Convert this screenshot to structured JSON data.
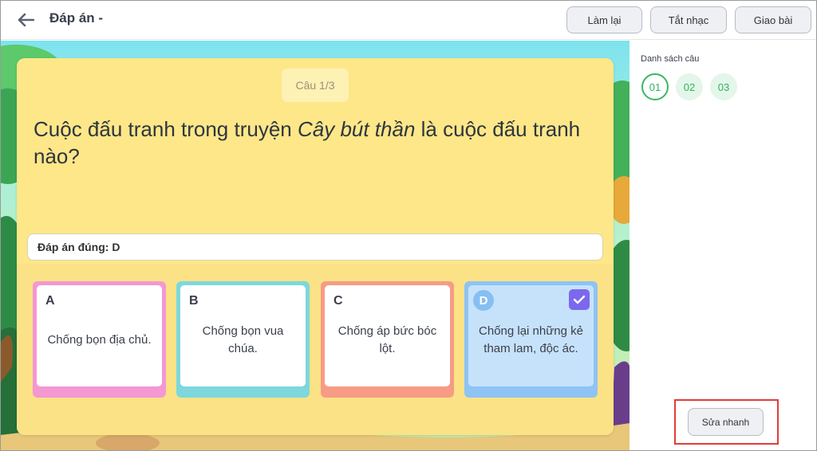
{
  "header": {
    "title": "Đáp án -",
    "buttons": {
      "retry": "Làm lại",
      "mute": "Tắt nhạc",
      "submit": "Giao bài"
    }
  },
  "question": {
    "number_label": "Câu 1/3",
    "text_before": "Cuộc đấu tranh trong truyện ",
    "text_italic": "Cây bút thần",
    "text_after": " là cuộc đấu tranh nào?",
    "correct_answer_label": "Đáp án đúng: D",
    "options": [
      {
        "letter": "A",
        "text": "Chống bọn địa chủ."
      },
      {
        "letter": "B",
        "text": "Chống bọn vua chúa."
      },
      {
        "letter": "C",
        "text": "Chống áp bức bóc lột."
      },
      {
        "letter": "D",
        "text": "Chống lại những kẻ tham lam, độc ác.",
        "selected": true
      }
    ]
  },
  "panel": {
    "title": "Danh sách câu",
    "questions": [
      {
        "label": "01",
        "active": true
      },
      {
        "label": "02",
        "active": false
      },
      {
        "label": "03",
        "active": false
      }
    ],
    "quick_edit": "Sửa nhanh"
  },
  "colors": {
    "card": "#fde788",
    "option_a": "#f497d2",
    "option_b": "#7cd8dd",
    "option_c": "#f79b85",
    "option_d": "#8ec3f4",
    "check": "#7b68ee",
    "question_active": "#38b861",
    "highlight": "#e23b3b"
  },
  "icons": {
    "back": "arrow-left-icon",
    "check": "check-icon"
  }
}
